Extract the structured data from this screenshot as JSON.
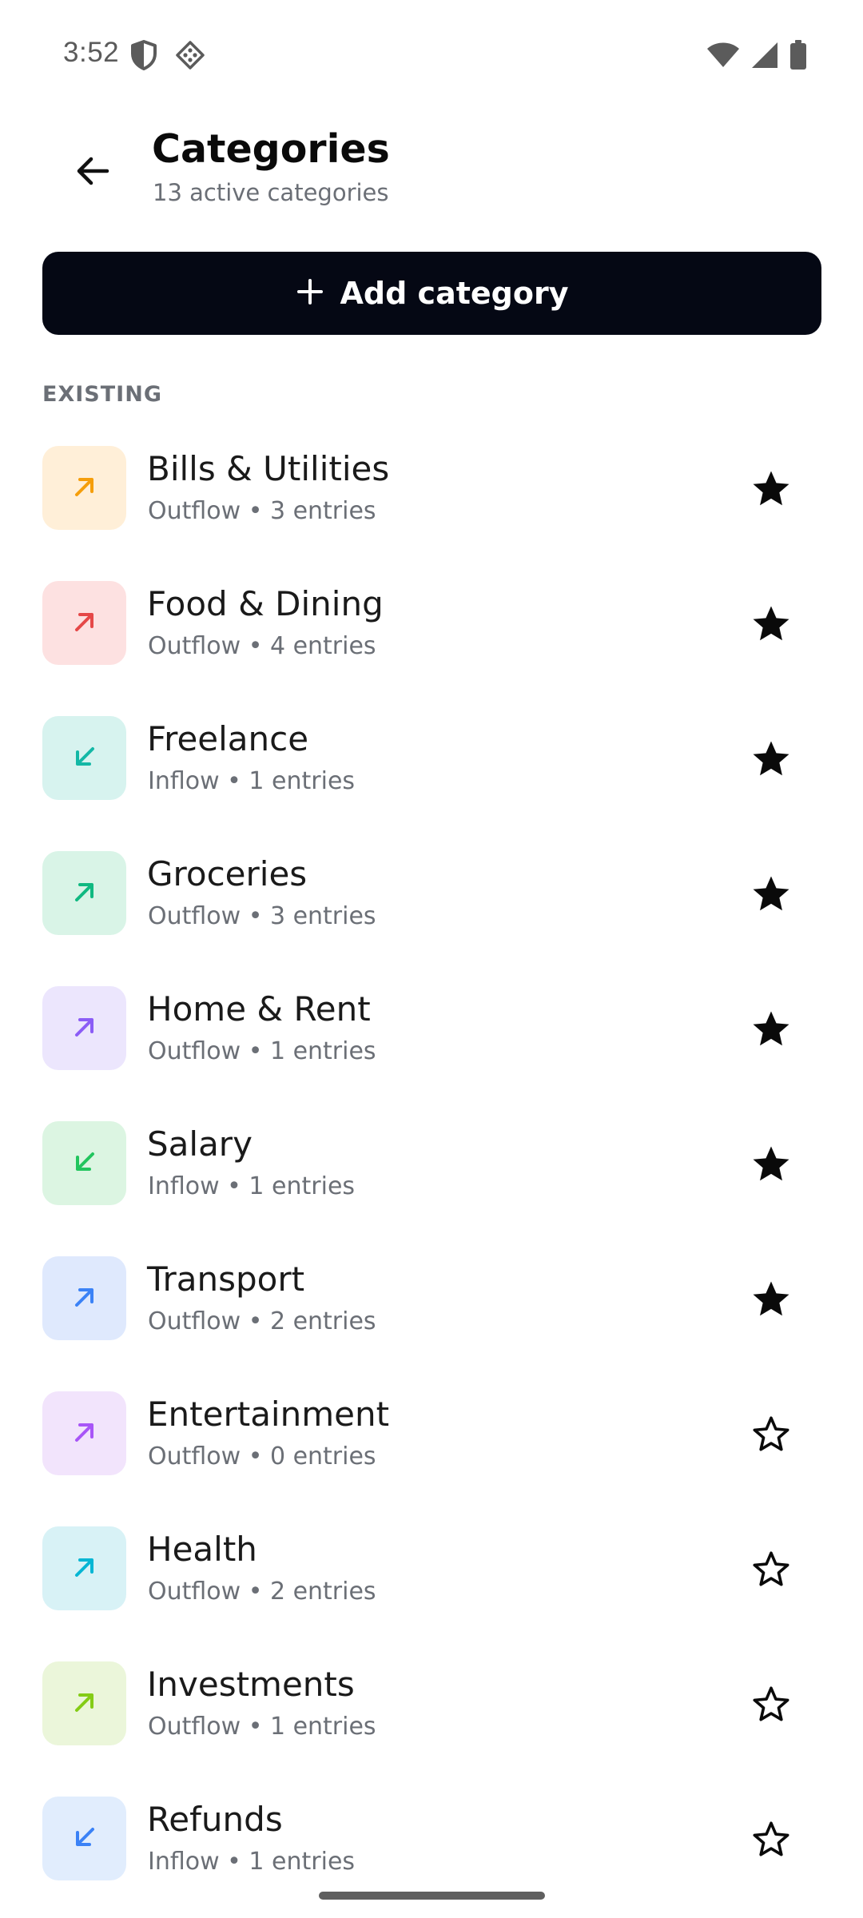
{
  "status_bar": {
    "time": "3:52",
    "left_icons": [
      "shield-icon",
      "vpn-diamond-icon"
    ],
    "right_icons": [
      "wifi-icon",
      "signal-icon",
      "battery-icon"
    ]
  },
  "header": {
    "back_icon": "arrow-left-icon",
    "title": "Categories",
    "subtitle": "13 active categories"
  },
  "add_button": {
    "icon": "plus-icon",
    "label": "Add category"
  },
  "section_label": "EXISTING",
  "categories": [
    {
      "name": "Bills & Utilities",
      "meta": "Outflow • 3 entries",
      "direction": "out",
      "starred": true,
      "bg": "#FFEFD8",
      "fg": "#F59E0B"
    },
    {
      "name": "Food & Dining",
      "meta": "Outflow • 4 entries",
      "direction": "out",
      "starred": true,
      "bg": "#FDE1E1",
      "fg": "#E54848"
    },
    {
      "name": "Freelance",
      "meta": "Inflow • 1 entries",
      "direction": "in",
      "starred": true,
      "bg": "#D7F3EF",
      "fg": "#14B8A6"
    },
    {
      "name": "Groceries",
      "meta": "Outflow • 3 entries",
      "direction": "out",
      "starred": true,
      "bg": "#D9F4E7",
      "fg": "#10B981"
    },
    {
      "name": "Home & Rent",
      "meta": "Outflow • 1 entries",
      "direction": "out",
      "starred": true,
      "bg": "#ECE6FD",
      "fg": "#8B5CF6"
    },
    {
      "name": "Salary",
      "meta": "Inflow • 1 entries",
      "direction": "in",
      "starred": true,
      "bg": "#DCF5E2",
      "fg": "#22C55E"
    },
    {
      "name": "Transport",
      "meta": "Outflow • 2 entries",
      "direction": "out",
      "starred": true,
      "bg": "#DFE9FD",
      "fg": "#3B82F6"
    },
    {
      "name": "Entertainment",
      "meta": "Outflow • 0 entries",
      "direction": "out",
      "starred": false,
      "bg": "#F2E4FC",
      "fg": "#A855F7"
    },
    {
      "name": "Health",
      "meta": "Outflow • 2 entries",
      "direction": "out",
      "starred": false,
      "bg": "#D8F2F6",
      "fg": "#06B6D4"
    },
    {
      "name": "Investments",
      "meta": "Outflow • 1 entries",
      "direction": "out",
      "starred": false,
      "bg": "#EBF6DA",
      "fg": "#84CC16"
    },
    {
      "name": "Refunds",
      "meta": "Inflow • 1 entries",
      "direction": "in",
      "starred": false,
      "bg": "#E1EDFD",
      "fg": "#3B82F6"
    }
  ]
}
